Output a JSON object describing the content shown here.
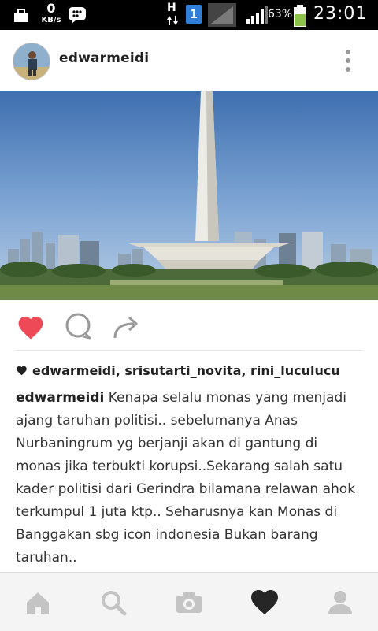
{
  "status_bar": {
    "data_rate_value": "0",
    "data_rate_unit": "KB/s",
    "network_type": "H",
    "sim_number": "1",
    "battery_percent": "63%",
    "time": "23:01"
  },
  "post": {
    "username": "edwarmeidi",
    "likes_text": "edwarmeidi, srisutarti_novita, rini_luculucu",
    "caption_author": "edwarmeidi",
    "caption_text": "Kenapa selalu monas yang menjadi ajang taruhan politisi.. sebelumanya Anas Nurbaningrum yg berjanji akan di gantung di monas jika terbukti korupsi..Sekarang salah satu kader politisi dari  Gerindra bilamana relawan ahok terkumpul 1 juta ktp.. Seharusnya kan Monas di Banggakan sbg icon indonesia Bukan barang taruhan..",
    "liked": true
  },
  "colors": {
    "like_red": "#ed4956",
    "nav_icon": "#c4c4c4",
    "nav_active": "#262626"
  },
  "bottom_nav": [
    "home-icon",
    "search-icon",
    "camera-icon",
    "heart-icon",
    "profile-icon"
  ]
}
